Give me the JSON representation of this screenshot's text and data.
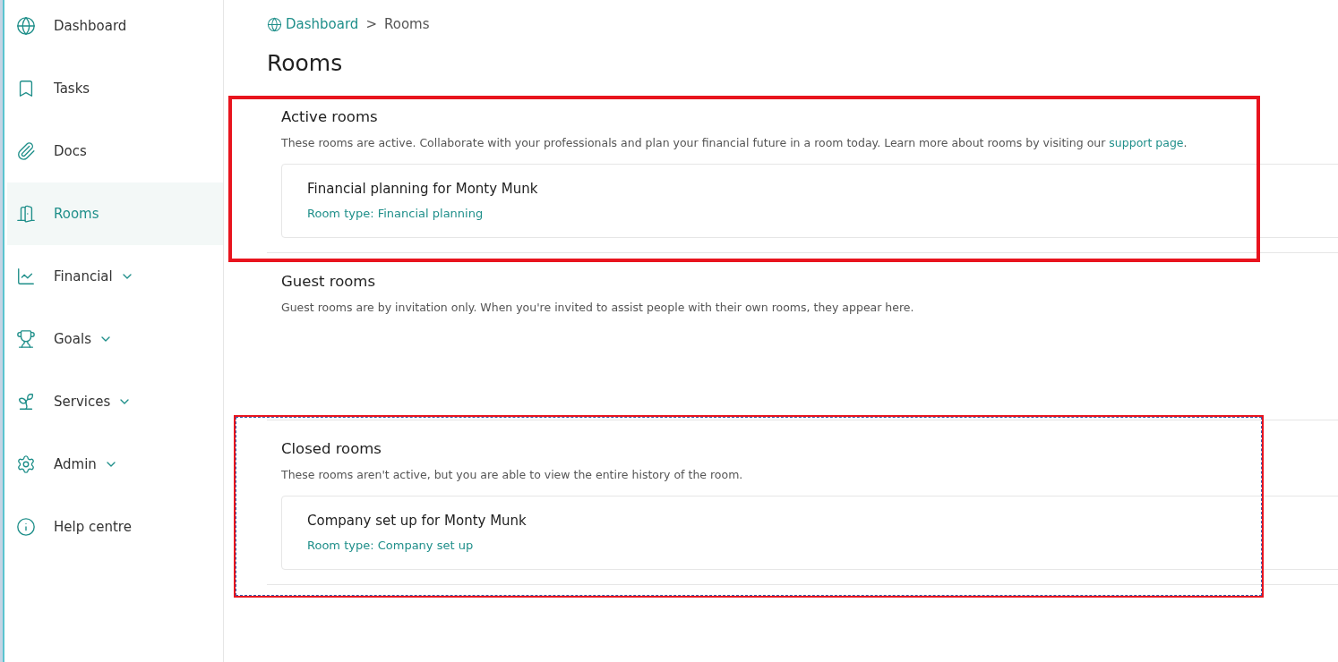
{
  "sidebar": {
    "items": [
      {
        "label": "Dashboard",
        "selected": false,
        "expandable": false
      },
      {
        "label": "Tasks",
        "selected": false,
        "expandable": false
      },
      {
        "label": "Docs",
        "selected": false,
        "expandable": false
      },
      {
        "label": "Rooms",
        "selected": true,
        "expandable": false
      },
      {
        "label": "Financial",
        "selected": false,
        "expandable": true
      },
      {
        "label": "Goals",
        "selected": false,
        "expandable": true
      },
      {
        "label": "Services",
        "selected": false,
        "expandable": true
      },
      {
        "label": "Admin",
        "selected": false,
        "expandable": true
      },
      {
        "label": "Help centre",
        "selected": false,
        "expandable": false
      }
    ]
  },
  "breadcrumb": {
    "link": "Dashboard",
    "separator": ">",
    "current": "Rooms"
  },
  "page_title": "Rooms",
  "sections": [
    {
      "kind": "solid-highlight",
      "title": "Active rooms",
      "description": "These rooms are active. Collaborate with your professionals and plan your financial future in a room today. Learn more about rooms by visiting our ",
      "link": "support page",
      "tail": ".",
      "rooms": [
        {
          "name": "Financial planning for Monty Munk",
          "type": "Room type: Financial planning"
        }
      ]
    },
    {
      "kind": "plain",
      "title": "Guest rooms",
      "description": "Guest rooms are by invitation only. When you're invited to assist people with their own rooms, they appear here."
    },
    {
      "kind": "dashed-highlight",
      "title": "Closed rooms",
      "description": "These rooms aren't active, but you are able to view the entire history of the room.",
      "rooms": [
        {
          "name": "Company set up for Monty Munk",
          "type": "Room type: Company set up"
        }
      ]
    }
  ]
}
